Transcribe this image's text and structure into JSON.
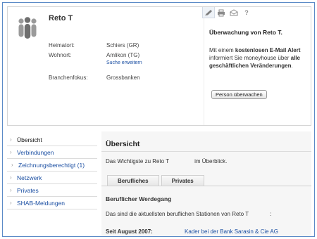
{
  "profile": {
    "name": "Reto T",
    "fields": [
      {
        "label": "Heimatort:",
        "value": "Schiers (GR)"
      },
      {
        "label": "Wohnort:",
        "value": "Amlikon (TG)"
      },
      {
        "label": "Branchenfokus:",
        "value": "Grossbanken"
      }
    ],
    "search_link": "Suche erweitern"
  },
  "toolbar": {
    "icons": [
      "pen-icon",
      "print-icon",
      "mail-icon",
      "help-icon"
    ],
    "help_glyph": "?"
  },
  "watch": {
    "title": "Überwachung von Reto T.",
    "text_1": "Mit einem ",
    "text_bold_1": "kostenlosen E-Mail Alert",
    "text_2": " informiert Sie moneyhouse über ",
    "text_bold_2": "alle geschäftlichen Veränderungen",
    "text_3": ".",
    "button": "Person überwachen"
  },
  "sidebar": {
    "items": [
      {
        "label": "Übersicht"
      },
      {
        "label": "Verbindungen"
      },
      {
        "label": "Zeichnungsberechtigt (1)"
      },
      {
        "label": "Netzwerk"
      },
      {
        "label": "Privates"
      },
      {
        "label": "SHAB-Meldungen"
      }
    ],
    "arrow": "›"
  },
  "main": {
    "title": "Übersicht",
    "intro_prefix": "Das Wichtigste zu Reto T",
    "intro_suffix": "im Überblick.",
    "tabs": [
      "Berufliches",
      "Privates"
    ],
    "section_title": "Beruflicher Werdegang",
    "section_desc_prefix": "Das sind die aktuellsten beruflichen Stationen von Reto T",
    "section_desc_suffix": ":",
    "since_label": "Seit August 2007:",
    "job_link": "Kader bei der Bank Sarasin & Cie AG"
  },
  "colors": {
    "link": "#1a4ea2",
    "frame": "#5b8ac7",
    "panel": "#f6f6f6"
  }
}
